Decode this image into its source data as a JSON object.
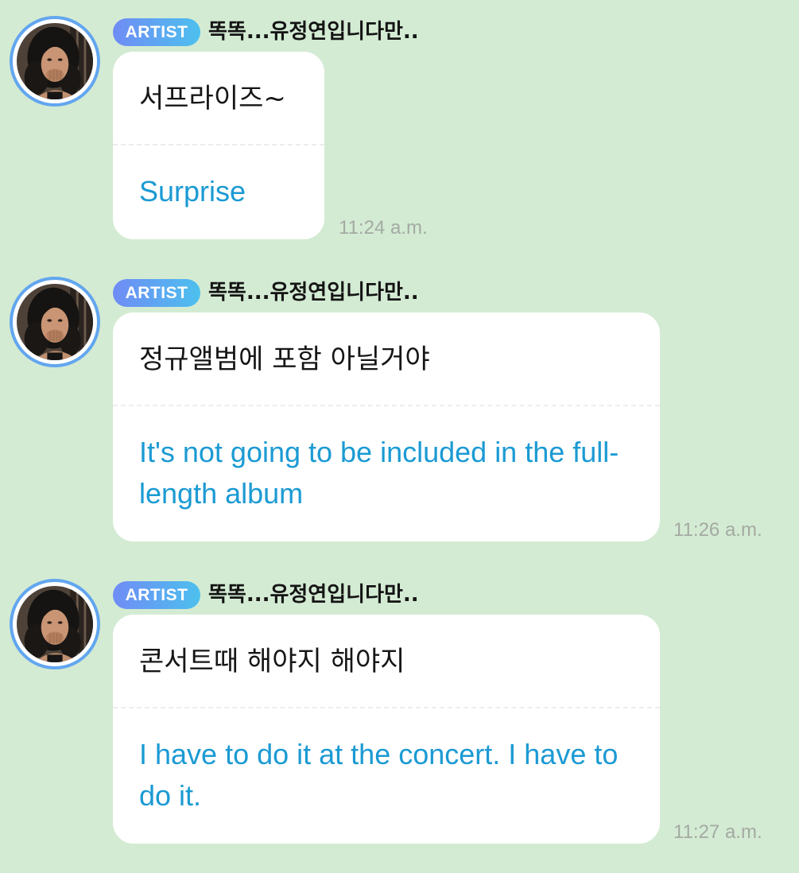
{
  "messages": [
    {
      "badge": "ARTIST",
      "sender": "똑똑...유정연입니다만..",
      "original": "서프라이즈~",
      "translation": "Surprise",
      "time": "11:24 a.m."
    },
    {
      "badge": "ARTIST",
      "sender": "똑똑...유정연입니다만..",
      "original": "정규앨범에 포함 아닐거야",
      "translation": "It's not going to be included in the full-length album",
      "time": "11:26 a.m."
    },
    {
      "badge": "ARTIST",
      "sender": "똑똑...유정연입니다만..",
      "original": "콘서트때 해야지 해야지",
      "translation": "I have to do it at the concert. I have to do it.",
      "time": "11:27 a.m."
    }
  ],
  "colors": {
    "background": "#d4ebd3",
    "avatar_ring": "#62a6ef",
    "badge_gradient_start": "#6f8cf5",
    "badge_gradient_end": "#4dc0ee",
    "translation_text": "#1b9ad3",
    "timestamp_text": "#a3aaa3"
  },
  "icons": {
    "avatar": "artist-avatar-photo"
  }
}
